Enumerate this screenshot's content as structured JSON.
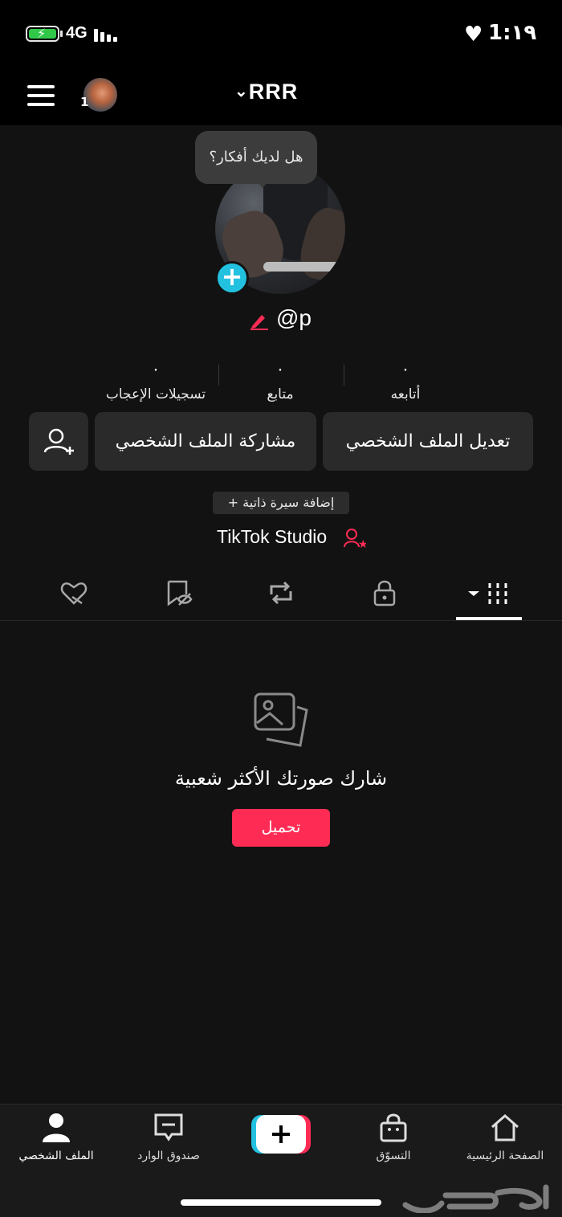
{
  "status_bar": {
    "network": "4G",
    "time": "1:١٩",
    "battery_level": 0.95
  },
  "header": {
    "title": "RRR",
    "notification_count": "1"
  },
  "profile": {
    "tooltip": "هل لديك أفكار؟",
    "username": "@p",
    "stats": [
      {
        "value": "٠",
        "label": "أتابعه"
      },
      {
        "value": "٠",
        "label": "متابع"
      },
      {
        "value": "٠",
        "label": "تسجيلات الإعجاب"
      }
    ],
    "buttons": {
      "edit": "تعديل الملف الشخصي",
      "share": "مشاركة الملف الشخصي"
    },
    "add_bio": "+ إضافة سيرة ذاتية",
    "studio": "TikTok Studio"
  },
  "empty_state": {
    "message": "شارك صورتك الأكثر شعبية",
    "upload": "تحميل"
  },
  "bottom_nav": {
    "home": "الصفحة الرئيسية",
    "shop": "التسوّق",
    "inbox": "صندوق الوارد",
    "profile": "الملف الشخصي"
  },
  "colors": {
    "accent_red": "#fe2c55",
    "accent_cyan": "#23c1e0",
    "background": "#121212"
  }
}
